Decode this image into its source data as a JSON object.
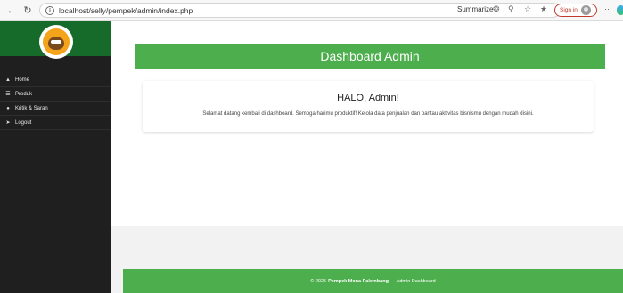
{
  "browser": {
    "url": "localhost/selly/pempek/admin/index.php",
    "summarize_label": "Summarize",
    "signin_label": "Sign in",
    "more_label": "···"
  },
  "sidebar": {
    "items": [
      {
        "label": "Home",
        "icon": "home-icon"
      },
      {
        "label": "Produk",
        "icon": "list-icon"
      },
      {
        "label": "Kritik & Saran",
        "icon": "comment-icon"
      },
      {
        "label": "Logout",
        "icon": "logout-icon"
      }
    ]
  },
  "main": {
    "header_title": "Dashboard Admin",
    "greeting": "HALO, Admin!",
    "welcome_text": "Selamat datang kembali di dashboard. Semoga harimu produktif! Kelola data penjualan dan pantau aktivitas bisnismu dengan mudah disini."
  },
  "footer": {
    "prefix": "© 2025",
    "brand": "Pempek Mona Palembang",
    "suffix": "— Admin Dashboard"
  },
  "colors": {
    "sidebar_bg": "#1f1f1f",
    "sidebar_top": "#166a2a",
    "accent_green": "#4cae4c",
    "signin_red": "#c0392b"
  }
}
